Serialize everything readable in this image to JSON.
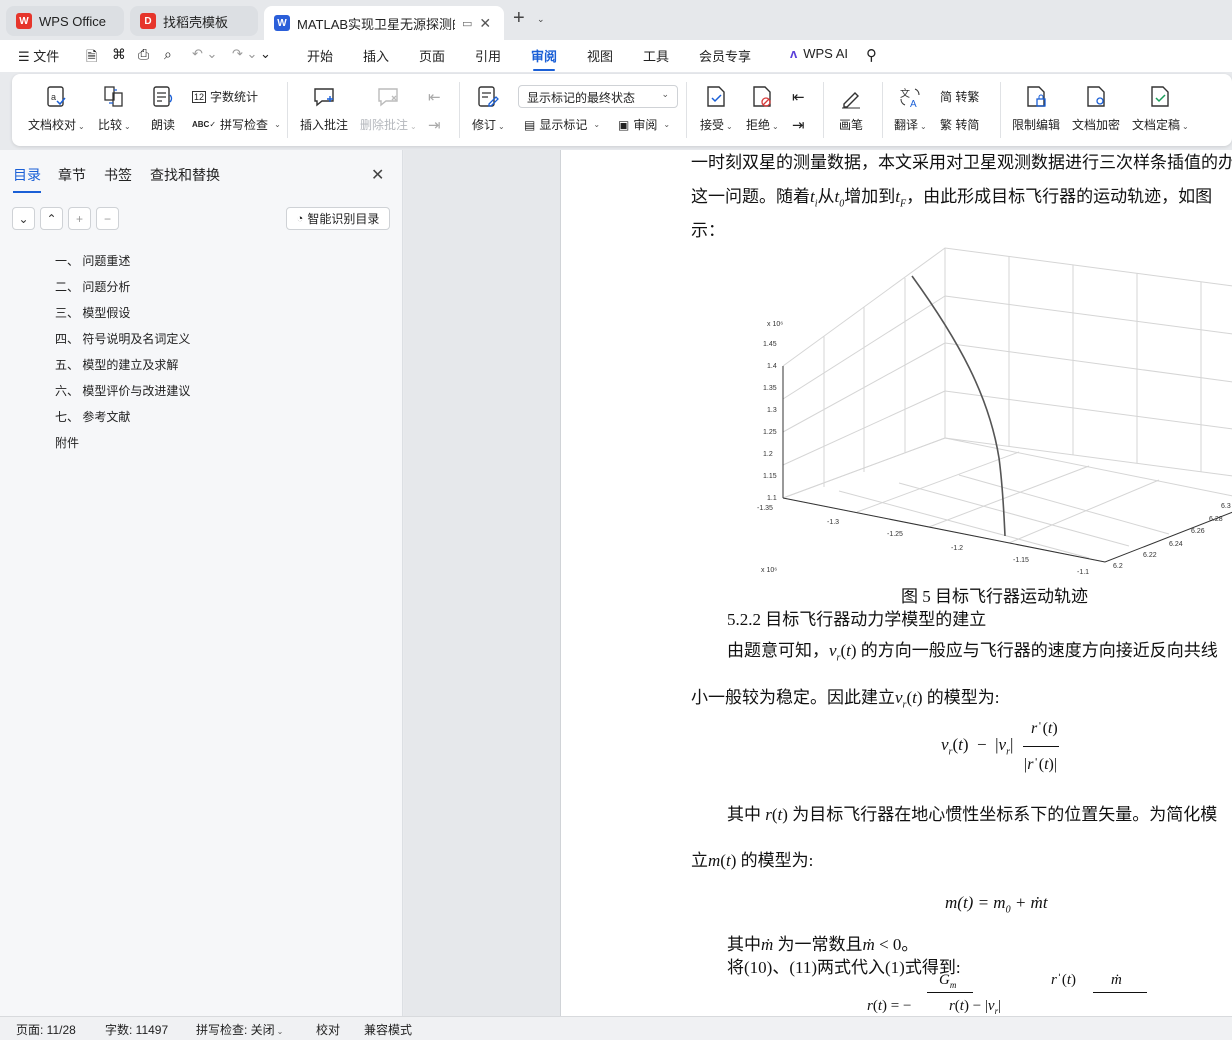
{
  "tabs": [
    {
      "label": "WPS Office",
      "icon": "wps-logo-icon",
      "color": "#e6352b"
    },
    {
      "label": "找稻壳模板",
      "icon": "docer-icon",
      "color": "#e6352b"
    },
    {
      "label": "MATLAB实现卫星无源探测的飞",
      "icon": "writer-w-icon",
      "color": "#2b5fd9"
    }
  ],
  "menu": {
    "file": "文件",
    "items": [
      "开始",
      "插入",
      "页面",
      "引用",
      "审阅",
      "视图",
      "工具",
      "会员专享"
    ],
    "active": "审阅",
    "wps_ai": "WPS AI"
  },
  "ribbon": {
    "doc_check": "文档校对",
    "compare": "比较",
    "read_aloud": "朗读",
    "word_count": "字数统计",
    "spell_check": "拼写检查",
    "insert_comment": "插入批注",
    "delete_comment": "删除批注",
    "revise": "修订",
    "display_state": "显示标记的最终状态",
    "show_markup": "显示标记",
    "review": "审阅",
    "accept": "接受",
    "reject": "拒绝",
    "pen": "画笔",
    "translate": "翻译",
    "to_traditional": "简 转繁",
    "to_simplified": "繁 转简",
    "restrict_edit": "限制编辑",
    "encrypt": "文档加密",
    "finalize": "文档定稿"
  },
  "left_pane": {
    "tabs": [
      "目录",
      "章节",
      "书签",
      "查找和替换"
    ],
    "smart_toc": "智能识别目录",
    "toc": [
      "一、 问题重述",
      "二、 问题分析",
      "三、 模型假设",
      "四、 符号说明及名词定义",
      "五、 模型的建立及求解",
      "六、 模型评价与改进建议",
      "七、 参考文献",
      "附件"
    ]
  },
  "doc": {
    "line1": "一时刻双星的测量数据，本文采用对卫星观测数据进行三次样条插值的办",
    "line2a": "这一问题。随着",
    "line2b": "从",
    "line2c": "增加到",
    "line2d": "，由此形成目标飞行器的运动轨迹，如图",
    "line3": "示：",
    "figure_caption": "图 5     目标飞行器运动轨迹",
    "section": "5.2.2     目标飞行器动力学模型的建立",
    "para1": "由题意可知，",
    "para1b": "的方向一般应与飞行器的速度方向接近反向共线",
    "para2": "小一般较为稳定。因此建立",
    "para2b": "的模型为:",
    "para3": "其中",
    "para3b": "为目标飞行器在地心惯性坐标系下的位置矢量。为简化模",
    "para4": "立",
    "para4b": "的模型为:",
    "eq_m": "m(t) = m",
    "eq_m2": " + ṁt",
    "para5": "其中",
    "para5b": "为一常数且",
    "para5c": "。",
    "para6": "将(10)、(11)两式代入(1)式得到:"
  },
  "chart_data": {
    "type": "line3d",
    "xlabel": "x 10⁶",
    "zlabel": "x 10⁶",
    "z_ticks": [
      "1.1",
      "1.15",
      "1.2",
      "1.25",
      "1.3",
      "1.35",
      "1.4",
      "1.45"
    ],
    "x_ticks": [
      "-1.35",
      "-1.3",
      "-1.25",
      "-1.2",
      "-1.15",
      "-1.1"
    ],
    "y_ticks": [
      "6.2",
      "6.22",
      "6.24",
      "6.26",
      "6.28",
      "6.3"
    ]
  },
  "status": {
    "page": "页面: 11/28",
    "words": "字数: 11497",
    "spell": "拼写检查: 关闭",
    "proof": "校对",
    "compat": "兼容模式"
  }
}
